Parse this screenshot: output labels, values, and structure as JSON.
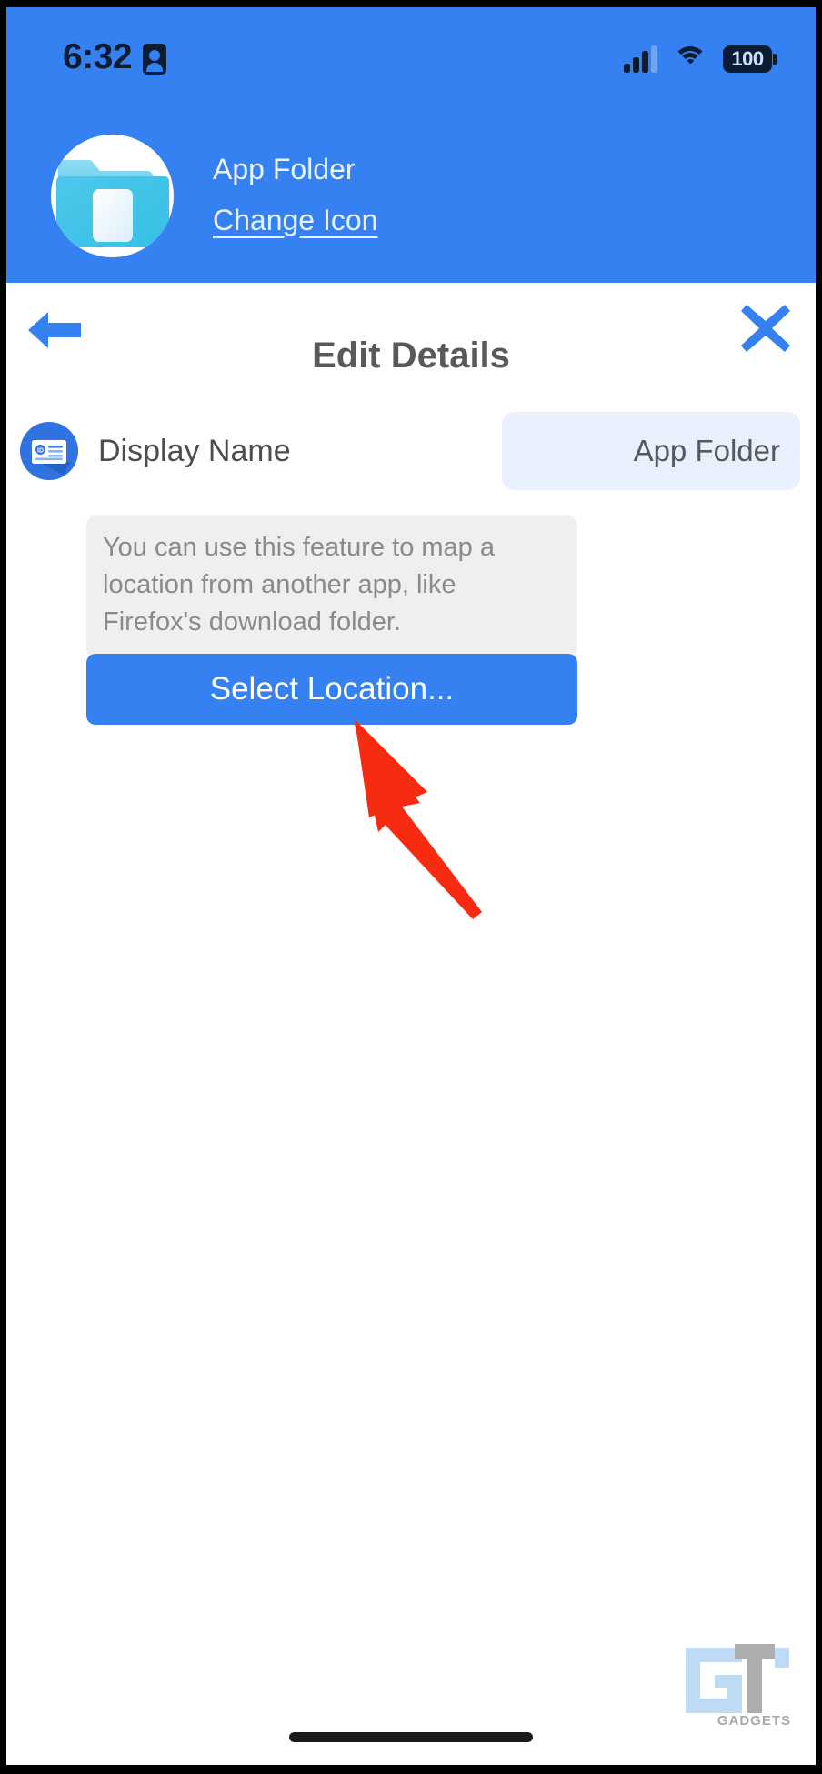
{
  "status_bar": {
    "time": "6:32",
    "contact_icon": "contact-card-icon",
    "signal_icon": "cellular-signal-icon",
    "wifi_icon": "wifi-icon",
    "battery_level": "100",
    "battery_icon": "battery-icon"
  },
  "header": {
    "app_icon": "folder-app-icon",
    "app_name": "App Folder",
    "change_icon_label": "Change Icon"
  },
  "modal": {
    "back_icon": "back-arrow-icon",
    "close_icon": "close-x-icon",
    "title": "Edit Details"
  },
  "form": {
    "display_name": {
      "icon": "id-card-icon",
      "label": "Display Name",
      "value": "App Folder"
    },
    "hint": "You can use this feature to map a location from another app, like Firefox's download folder.",
    "select_location_label": "Select Location..."
  },
  "annotation": {
    "arrow_icon": "red-pointer-arrow-icon",
    "arrow_color": "#f62b11"
  },
  "watermark": {
    "logo_icon": "gt-logo-icon",
    "label": "GADGETS"
  },
  "colors": {
    "brand_blue": "#3581f2",
    "header_blue": "#3581f2",
    "field_bg": "#e8f0fe",
    "hint_bg": "#efefef",
    "title_gray": "#595959"
  }
}
